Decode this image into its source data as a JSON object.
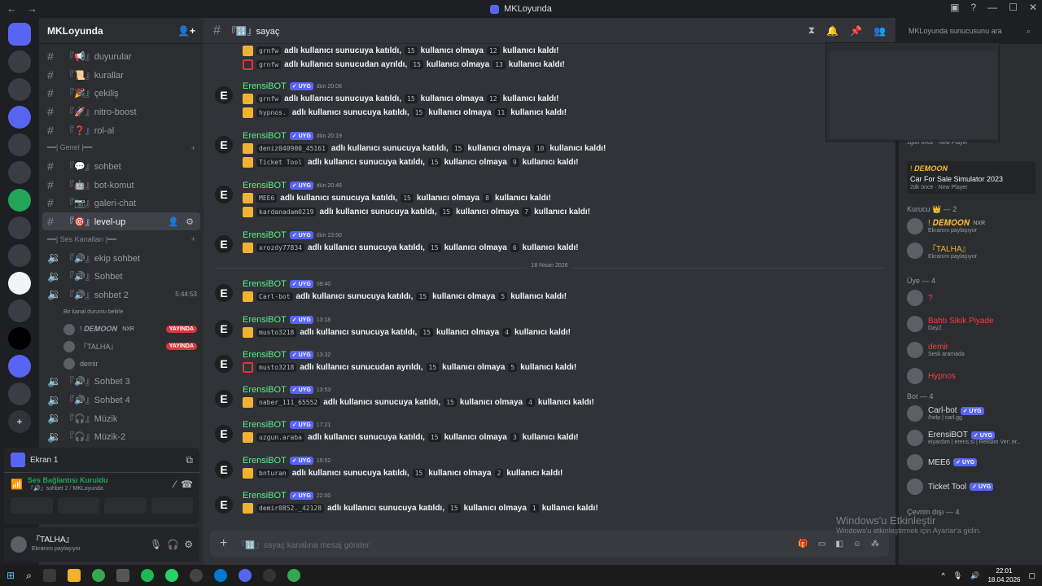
{
  "window": {
    "title": "MKLoyunda"
  },
  "server": {
    "name": "MKLoyunda"
  },
  "channels_top": [
    {
      "label": "『📢』duyurular"
    },
    {
      "label": "『📜』kurallar"
    },
    {
      "label": "『🎉』çekiliş"
    },
    {
      "label": "『🚀』nitro-boost"
    },
    {
      "label": "『❓』rol-al"
    }
  ],
  "cat_genel": "━━| Genel |━━",
  "channels_genel": [
    {
      "label": "『💬』sohbet"
    },
    {
      "label": "『🤖』bot-komut"
    },
    {
      "label": "『📷』galeri-chat"
    },
    {
      "label": "『🎯』level-up"
    }
  ],
  "cat_ses": "━━| Ses Kanalları |━━",
  "voice": [
    {
      "label": "『🔊』ekip sohbet"
    },
    {
      "label": "『🔊』Sohbet"
    },
    {
      "label": "『🔊』sohbet 2",
      "time": "5:44:53"
    }
  ],
  "voice_status": "Bir kanal durumu belirle",
  "voice_users": [
    {
      "name": "! 𝑫𝑬𝑴𝑶𝑶𝑵",
      "badge": "NXR",
      "live": "YAYINDA"
    },
    {
      "name": "『TALHA』",
      "live": "YAYINDA"
    },
    {
      "name": "demir"
    }
  ],
  "voice_more": [
    {
      "label": "『🔊』Sohbet 3"
    },
    {
      "label": "『🔊』Sohbet 4"
    },
    {
      "label": "『🎧』Müzik"
    },
    {
      "label": "『🎧』Müzik-2"
    }
  ],
  "screen": {
    "label": "Ekran 1"
  },
  "voice_conn": {
    "title": "Ses Bağlantısı Kuruldu",
    "sub": "『🔊』sohbet 2 / MKLoyunda"
  },
  "me": {
    "name": "『TALHA』",
    "status": "Ekranını paylaşıyor"
  },
  "channel": {
    "name": "『🔢』sayaç"
  },
  "search": {
    "placeholder": "MKLoyunda sunucusunu ara"
  },
  "bot": {
    "name": "ErensiBOT",
    "tag": "✓ UYG"
  },
  "w": {
    "join": "adlı kullanıcı sunucuya katıldı,",
    "left": "adlı kullanıcı sunucudan ayrıldı,",
    "need": "kullanıcı olmaya",
    "done": "kullanıcı kaldı!"
  },
  "top_lines": [
    {
      "user": "grnfw",
      "n1": "15",
      "n2": "12",
      "type": "join"
    },
    {
      "user": "grnfw",
      "n1": "15",
      "n2": "13",
      "type": "left"
    }
  ],
  "messages": [
    {
      "time": "dün 20:08",
      "lines": [
        {
          "user": "grnfw",
          "n1": "15",
          "n2": "12",
          "type": "join"
        },
        {
          "user": "hypnos.",
          "n1": "15",
          "n2": "11",
          "type": "join"
        }
      ]
    },
    {
      "time": "dün 20:19",
      "lines": [
        {
          "user": "deniz040900_45161",
          "n1": "15",
          "n2": "10",
          "type": "join"
        },
        {
          "user": "Ticket Tool",
          "n1": "15",
          "n2": "9",
          "type": "join"
        }
      ]
    },
    {
      "time": "dün 20:46",
      "lines": [
        {
          "user": "MEE6",
          "n1": "15",
          "n2": "8",
          "type": "join"
        },
        {
          "user": "kardanadam0219",
          "n1": "15",
          "n2": "7",
          "type": "join"
        }
      ]
    },
    {
      "time": "dün 23:50",
      "lines": [
        {
          "user": "xrozdy77834",
          "n1": "15",
          "n2": "6",
          "type": "join"
        }
      ]
    },
    {
      "time": "09:40",
      "lines": [
        {
          "user": "Carl-bot",
          "n1": "15",
          "n2": "5",
          "type": "join"
        }
      ]
    },
    {
      "time": "13:18",
      "lines": [
        {
          "user": "musto3218",
          "n1": "15",
          "n2": "4",
          "type": "join"
        }
      ]
    },
    {
      "time": "13:32",
      "lines": [
        {
          "user": "musto3218",
          "n1": "15",
          "n2": "5",
          "type": "left"
        }
      ]
    },
    {
      "time": "13:53",
      "lines": [
        {
          "user": "naber_111_65552",
          "n1": "15",
          "n2": "4",
          "type": "join"
        }
      ]
    },
    {
      "time": "17:21",
      "lines": [
        {
          "user": "uzgun.araba",
          "n1": "15",
          "n2": "3",
          "type": "join"
        }
      ]
    },
    {
      "time": "19:52",
      "lines": [
        {
          "user": "bnturan",
          "n1": "15",
          "n2": "2",
          "type": "join"
        }
      ]
    },
    {
      "time": "22:00",
      "lines": [
        {
          "user": "demir0852._42128",
          "n1": "15",
          "n2": "1",
          "type": "join"
        }
      ]
    }
  ],
  "date_divider": "18 Nisan 2026",
  "composer": {
    "placeholder": "『🔢』sayaç kanalına mesaj gönder"
  },
  "activity": [
    {
      "line": "1gün önce",
      "sub": "New Player"
    },
    {
      "name": "! 𝑫𝑬𝑴𝑶𝑶𝑵",
      "game": "Car For Sale Simulator 2023",
      "line": "2dk önce",
      "sub": "New Player"
    }
  ],
  "groups": {
    "kurucu": "Kurucu 👑 — 2",
    "uye": "Üye — 4",
    "bot": "Bot — 4",
    "offline": "Çevrim dışı — 4"
  },
  "kurucu": [
    {
      "name": "! 𝑫𝑬𝑴𝑶𝑶𝑵",
      "badge": "NXR",
      "status": "Ekranını paylaşıyor"
    },
    {
      "name": "『TALHA』",
      "status": "Ekranını paylaşıyor"
    }
  ],
  "uye": [
    {
      "name": "?",
      "status": "",
      "color": "#f23f43"
    },
    {
      "name": "Bahtı Sikik Piyade",
      "status": "DayZ",
      "color": "#f23f43"
    },
    {
      "name": "demir",
      "status": "Sesli aramada",
      "color": "#f23f43"
    },
    {
      "name": "Hypnos",
      "status": "",
      "color": "#f23f43"
    }
  ],
  "bots": [
    {
      "name": "Carl-bot",
      "tag": "✓ UYG",
      "status": "/help | carl.gg"
    },
    {
      "name": "ErensiBOT",
      "tag": "✓ UYG",
      "status": "eiyardım | erens.si | Reklam Ver: er..."
    },
    {
      "name": "MEE6",
      "tag": "✓ UYG",
      "status": ""
    },
    {
      "name": "Ticket Tool",
      "tag": "✓ UYG",
      "status": ""
    }
  ],
  "watermark": {
    "title": "Windows'u Etkinleştir",
    "sub": "Windows'u etkinleştirmek için Ayarlar'a gidin."
  },
  "taskbar": {
    "time": "22:01",
    "date": "18.04.2026"
  },
  "colors": {
    "accent": "#5865f2",
    "bot_green": "#57f287",
    "live": "#da373c"
  }
}
